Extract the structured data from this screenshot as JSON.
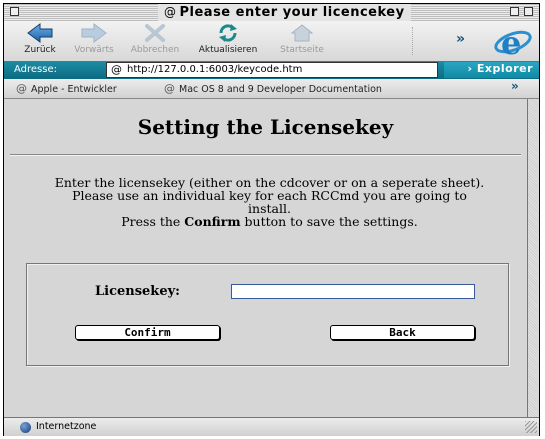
{
  "window": {
    "title": "Please enter your licencekey",
    "title_icon": "@"
  },
  "toolbar": {
    "buttons": [
      {
        "label": "Zurück",
        "icon": "back-arrow-icon",
        "enabled": true
      },
      {
        "label": "Vorwärts",
        "icon": "forward-arrow-icon",
        "enabled": false
      },
      {
        "label": "Abbrechen",
        "icon": "stop-x-icon",
        "enabled": false
      },
      {
        "label": "Aktualisieren",
        "icon": "refresh-icon",
        "enabled": true
      },
      {
        "label": "Startseite",
        "icon": "home-icon",
        "enabled": false
      }
    ],
    "more": "»"
  },
  "address": {
    "label": "Adresse:",
    "url": "http://127.0.0.1:6003/keycode.htm",
    "explorer": "› Explorer"
  },
  "favorites": {
    "items": [
      {
        "label": "Apple - Entwickler"
      },
      {
        "label": "Mac OS 8 and 9 Developer Documentation"
      }
    ],
    "more": "»"
  },
  "page": {
    "heading": "Setting the Licensekey",
    "desc_line1": "Enter the licensekey (either on the cdcover or on a seperate sheet).",
    "desc_line2": "Please use an individual key for each RCCmd you are going to",
    "desc_line3": "install.",
    "desc_line4_pre": "Press the ",
    "desc_line4_bold": "Confirm",
    "desc_line4_post": " button to save the settings.",
    "license_label": "Licensekey:",
    "license_value": "",
    "confirm_label": "Confirm",
    "back_label": "Back"
  },
  "status": {
    "zone": "Internetzone"
  },
  "colors": {
    "address_bar": "#0d7a92",
    "explorer_button": "#1a9ab6",
    "background": "#d6d6d6"
  }
}
